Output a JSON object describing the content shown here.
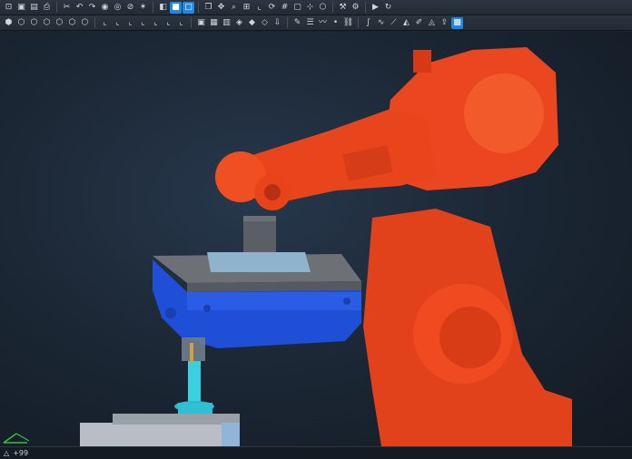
{
  "toolbar_row1": [
    {
      "name": "open-file-icon",
      "glyph": "⊡"
    },
    {
      "name": "new-file-icon",
      "glyph": "▣"
    },
    {
      "name": "save-icon",
      "glyph": "▤"
    },
    {
      "name": "print-icon",
      "glyph": "⎙"
    },
    {
      "sep": true
    },
    {
      "name": "cut-icon",
      "glyph": "✂"
    },
    {
      "name": "undo-icon",
      "glyph": "↶"
    },
    {
      "name": "redo-icon",
      "glyph": "↷"
    },
    {
      "name": "visibility-icon",
      "glyph": "◉"
    },
    {
      "name": "eye-icon",
      "glyph": "◎"
    },
    {
      "name": "hide-icon",
      "glyph": "⊘"
    },
    {
      "name": "lighting-icon",
      "glyph": "✶"
    },
    {
      "sep": true
    },
    {
      "name": "shaded-icon",
      "glyph": "◧"
    },
    {
      "name": "solid-view-icon",
      "glyph": "■",
      "active": true
    },
    {
      "name": "wireframe-view-icon",
      "glyph": "□",
      "active": true
    },
    {
      "sep": true
    },
    {
      "name": "copy-icon",
      "glyph": "❐"
    },
    {
      "name": "pan-icon",
      "glyph": "✥"
    },
    {
      "name": "zoom-icon",
      "glyph": "⌕"
    },
    {
      "name": "zoom-fit-icon",
      "glyph": "⊞"
    },
    {
      "name": "measure-icon",
      "glyph": "⌞"
    },
    {
      "name": "rotate-icon",
      "glyph": "⟳"
    },
    {
      "name": "grid-icon",
      "glyph": "#"
    },
    {
      "name": "frame-icon",
      "glyph": "▢"
    },
    {
      "name": "axis-icon",
      "glyph": "⊹"
    },
    {
      "name": "cube-icon",
      "glyph": "⬡"
    },
    {
      "sep": true
    },
    {
      "name": "tool-icon",
      "glyph": "⚒"
    },
    {
      "name": "robot-icon",
      "glyph": "⚙"
    },
    {
      "sep": true
    },
    {
      "name": "simulation-icon",
      "glyph": "▶"
    },
    {
      "name": "jog-icon",
      "glyph": "↻"
    }
  ],
  "toolbar_row2": [
    {
      "name": "iso-view-icon",
      "glyph": "⬢"
    },
    {
      "name": "front-view-icon",
      "glyph": "⬡"
    },
    {
      "name": "back-view-icon",
      "glyph": "⬡"
    },
    {
      "name": "left-view-icon",
      "glyph": "⬡"
    },
    {
      "name": "right-view-icon",
      "glyph": "⬡"
    },
    {
      "name": "top-view-icon",
      "glyph": "⬡"
    },
    {
      "name": "bottom-view-icon",
      "glyph": "⬡"
    },
    {
      "sep": true
    },
    {
      "name": "frame-xy-icon",
      "glyph": "⌞"
    },
    {
      "name": "frame-yz-icon",
      "glyph": "⌞"
    },
    {
      "name": "frame-zx-icon",
      "glyph": "⌞"
    },
    {
      "name": "frame-world-icon",
      "glyph": "⌞"
    },
    {
      "name": "frame-base-icon",
      "glyph": "⌞"
    },
    {
      "name": "frame-tool-icon",
      "glyph": "⌞"
    },
    {
      "name": "frame-user-icon",
      "glyph": "⌞"
    },
    {
      "sep": true
    },
    {
      "name": "layout-icon",
      "glyph": "▣"
    },
    {
      "name": "catalog-icon",
      "glyph": "▦"
    },
    {
      "name": "library-icon",
      "glyph": "▥"
    },
    {
      "name": "component-icon",
      "glyph": "◈"
    },
    {
      "name": "part-icon",
      "glyph": "◆"
    },
    {
      "name": "assembly-icon",
      "glyph": "◇"
    },
    {
      "name": "import-icon",
      "glyph": "⇩"
    },
    {
      "sep": true
    },
    {
      "name": "teach-icon",
      "glyph": "✎"
    },
    {
      "name": "program-icon",
      "glyph": "☰"
    },
    {
      "name": "path-icon",
      "glyph": "〰"
    },
    {
      "name": "point-icon",
      "glyph": "•"
    },
    {
      "name": "link-icon",
      "glyph": "⛓"
    },
    {
      "sep": true
    },
    {
      "name": "curve-icon",
      "glyph": "∫"
    },
    {
      "name": "spline-icon",
      "glyph": "∿"
    },
    {
      "name": "edge-icon",
      "glyph": "⟋"
    },
    {
      "name": "surface-icon",
      "glyph": "◭"
    },
    {
      "name": "brush-icon",
      "glyph": "✐"
    },
    {
      "name": "paint-icon",
      "glyph": "◬"
    },
    {
      "name": "export-icon",
      "glyph": "⇪"
    },
    {
      "name": "display-icon",
      "glyph": "▩",
      "active": true
    }
  ],
  "statusbar": {
    "coords_text": "+99"
  }
}
